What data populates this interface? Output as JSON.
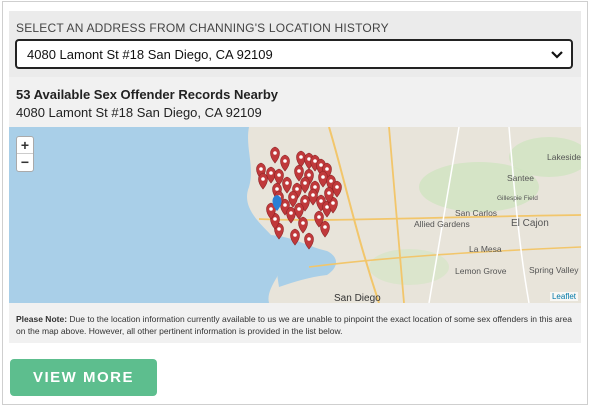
{
  "selector": {
    "heading": "SELECT AN ADDRESS FROM CHANNING'S LOCATION HISTORY",
    "selected_address": "4080 Lamont St #18 San Diego, CA 92109"
  },
  "results": {
    "count_title": "53 Available Sex Offender Records Nearby",
    "address": "4080 Lamont St #18 San Diego, CA 92109"
  },
  "map": {
    "zoom_in": "+",
    "zoom_out": "−",
    "attribution": "Leaflet",
    "place_labels": [
      "Lakeside",
      "Santee",
      "Gillespie Field",
      "San Carlos",
      "Allied Gardens",
      "El Cajon",
      "La Mesa",
      "Lemon Grove",
      "Spring Valley",
      "San Diego"
    ],
    "marker_color": "#c0393b",
    "home_marker_color": "#2a7fd4"
  },
  "note": {
    "label": "Please Note:",
    "text": " Due to the location information currently available to us we are unable to pinpoint the exact location of some sex offenders in this area on the map above. However, all other pertinent information is provided in the list below."
  },
  "view_more": "VIEW MORE"
}
